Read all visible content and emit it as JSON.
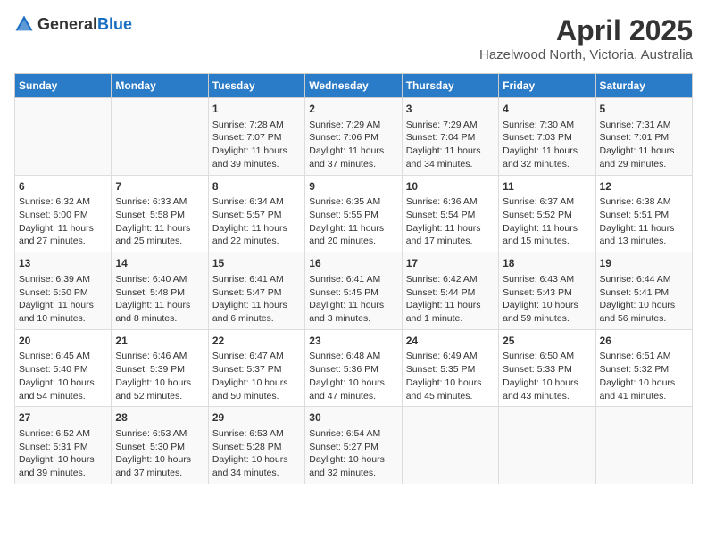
{
  "header": {
    "logo_general": "General",
    "logo_blue": "Blue",
    "title": "April 2025",
    "subtitle": "Hazelwood North, Victoria, Australia"
  },
  "calendar": {
    "weekdays": [
      "Sunday",
      "Monday",
      "Tuesday",
      "Wednesday",
      "Thursday",
      "Friday",
      "Saturday"
    ],
    "weeks": [
      [
        {
          "day": "",
          "info": ""
        },
        {
          "day": "",
          "info": ""
        },
        {
          "day": "1",
          "info": "Sunrise: 7:28 AM\nSunset: 7:07 PM\nDaylight: 11 hours and 39 minutes."
        },
        {
          "day": "2",
          "info": "Sunrise: 7:29 AM\nSunset: 7:06 PM\nDaylight: 11 hours and 37 minutes."
        },
        {
          "day": "3",
          "info": "Sunrise: 7:29 AM\nSunset: 7:04 PM\nDaylight: 11 hours and 34 minutes."
        },
        {
          "day": "4",
          "info": "Sunrise: 7:30 AM\nSunset: 7:03 PM\nDaylight: 11 hours and 32 minutes."
        },
        {
          "day": "5",
          "info": "Sunrise: 7:31 AM\nSunset: 7:01 PM\nDaylight: 11 hours and 29 minutes."
        }
      ],
      [
        {
          "day": "6",
          "info": "Sunrise: 6:32 AM\nSunset: 6:00 PM\nDaylight: 11 hours and 27 minutes."
        },
        {
          "day": "7",
          "info": "Sunrise: 6:33 AM\nSunset: 5:58 PM\nDaylight: 11 hours and 25 minutes."
        },
        {
          "day": "8",
          "info": "Sunrise: 6:34 AM\nSunset: 5:57 PM\nDaylight: 11 hours and 22 minutes."
        },
        {
          "day": "9",
          "info": "Sunrise: 6:35 AM\nSunset: 5:55 PM\nDaylight: 11 hours and 20 minutes."
        },
        {
          "day": "10",
          "info": "Sunrise: 6:36 AM\nSunset: 5:54 PM\nDaylight: 11 hours and 17 minutes."
        },
        {
          "day": "11",
          "info": "Sunrise: 6:37 AM\nSunset: 5:52 PM\nDaylight: 11 hours and 15 minutes."
        },
        {
          "day": "12",
          "info": "Sunrise: 6:38 AM\nSunset: 5:51 PM\nDaylight: 11 hours and 13 minutes."
        }
      ],
      [
        {
          "day": "13",
          "info": "Sunrise: 6:39 AM\nSunset: 5:50 PM\nDaylight: 11 hours and 10 minutes."
        },
        {
          "day": "14",
          "info": "Sunrise: 6:40 AM\nSunset: 5:48 PM\nDaylight: 11 hours and 8 minutes."
        },
        {
          "day": "15",
          "info": "Sunrise: 6:41 AM\nSunset: 5:47 PM\nDaylight: 11 hours and 6 minutes."
        },
        {
          "day": "16",
          "info": "Sunrise: 6:41 AM\nSunset: 5:45 PM\nDaylight: 11 hours and 3 minutes."
        },
        {
          "day": "17",
          "info": "Sunrise: 6:42 AM\nSunset: 5:44 PM\nDaylight: 11 hours and 1 minute."
        },
        {
          "day": "18",
          "info": "Sunrise: 6:43 AM\nSunset: 5:43 PM\nDaylight: 10 hours and 59 minutes."
        },
        {
          "day": "19",
          "info": "Sunrise: 6:44 AM\nSunset: 5:41 PM\nDaylight: 10 hours and 56 minutes."
        }
      ],
      [
        {
          "day": "20",
          "info": "Sunrise: 6:45 AM\nSunset: 5:40 PM\nDaylight: 10 hours and 54 minutes."
        },
        {
          "day": "21",
          "info": "Sunrise: 6:46 AM\nSunset: 5:39 PM\nDaylight: 10 hours and 52 minutes."
        },
        {
          "day": "22",
          "info": "Sunrise: 6:47 AM\nSunset: 5:37 PM\nDaylight: 10 hours and 50 minutes."
        },
        {
          "day": "23",
          "info": "Sunrise: 6:48 AM\nSunset: 5:36 PM\nDaylight: 10 hours and 47 minutes."
        },
        {
          "day": "24",
          "info": "Sunrise: 6:49 AM\nSunset: 5:35 PM\nDaylight: 10 hours and 45 minutes."
        },
        {
          "day": "25",
          "info": "Sunrise: 6:50 AM\nSunset: 5:33 PM\nDaylight: 10 hours and 43 minutes."
        },
        {
          "day": "26",
          "info": "Sunrise: 6:51 AM\nSunset: 5:32 PM\nDaylight: 10 hours and 41 minutes."
        }
      ],
      [
        {
          "day": "27",
          "info": "Sunrise: 6:52 AM\nSunset: 5:31 PM\nDaylight: 10 hours and 39 minutes."
        },
        {
          "day": "28",
          "info": "Sunrise: 6:53 AM\nSunset: 5:30 PM\nDaylight: 10 hours and 37 minutes."
        },
        {
          "day": "29",
          "info": "Sunrise: 6:53 AM\nSunset: 5:28 PM\nDaylight: 10 hours and 34 minutes."
        },
        {
          "day": "30",
          "info": "Sunrise: 6:54 AM\nSunset: 5:27 PM\nDaylight: 10 hours and 32 minutes."
        },
        {
          "day": "",
          "info": ""
        },
        {
          "day": "",
          "info": ""
        },
        {
          "day": "",
          "info": ""
        }
      ]
    ]
  }
}
